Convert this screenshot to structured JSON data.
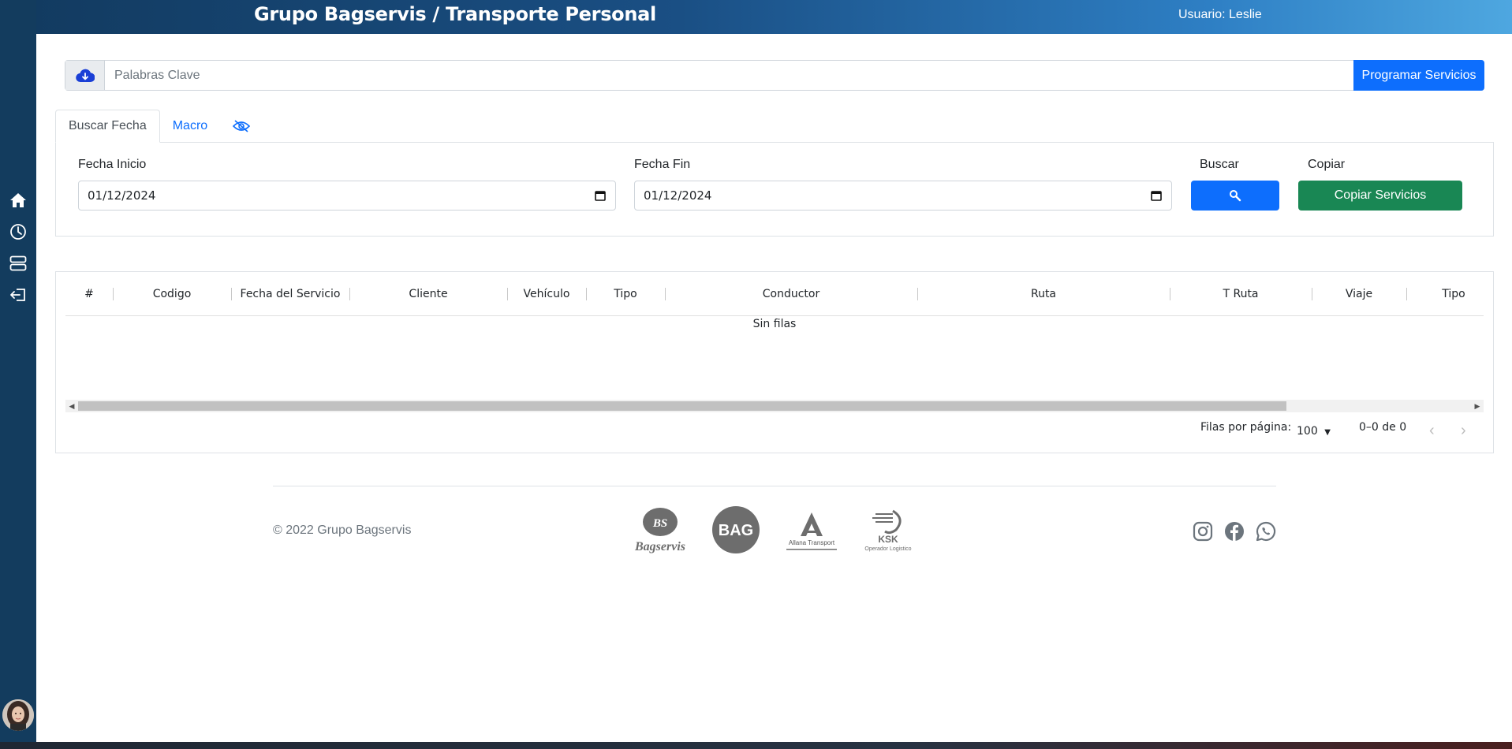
{
  "header": {
    "title": "Grupo Bagservis / Transporte Personal",
    "user_label": "Usuario: Leslie"
  },
  "sidebar": {
    "icons": [
      "home-icon",
      "history-icon",
      "servers-icon",
      "logout-icon"
    ]
  },
  "search": {
    "placeholder": "Palabras Clave",
    "action_label": "Programar Servicios"
  },
  "tabs": [
    {
      "label": "Buscar Fecha",
      "active": true
    },
    {
      "label": "Macro",
      "active": false
    }
  ],
  "filters": {
    "start_label": "Fecha Inicio",
    "start_value": "01/12/2024",
    "end_label": "Fecha Fin",
    "end_value": "01/12/2024",
    "search_label": "Buscar",
    "copy_label": "Copiar",
    "copy_button": "Copiar Servicios"
  },
  "table": {
    "columns": [
      "#",
      "Codigo",
      "Fecha del Servicio",
      "Cliente",
      "Vehículo",
      "Tipo",
      "Conductor",
      "Ruta",
      "T Ruta",
      "Viaje",
      "Tipo"
    ],
    "empty_text": "Sin filas",
    "rows_per_page_label": "Filas por página:",
    "rows_per_page_value": "100",
    "range_text": "0–0 de 0"
  },
  "footer": {
    "copyright": "© 2022 Grupo Bagservis",
    "logos": [
      {
        "name": "bagservis-logo",
        "text": "Bagservis",
        "mark": "BS"
      },
      {
        "name": "bag-logo",
        "text": "BAG"
      },
      {
        "name": "allana-logo",
        "text": "Allana Transport"
      },
      {
        "name": "ksk-logo",
        "text": "KSK",
        "subtext": "Operador Logistico"
      }
    ],
    "social": [
      "instagram-icon",
      "facebook-icon",
      "whatsapp-icon"
    ]
  },
  "colors": {
    "primary": "#0d6efd",
    "success": "#198754",
    "sidebar": "#133c5e"
  }
}
